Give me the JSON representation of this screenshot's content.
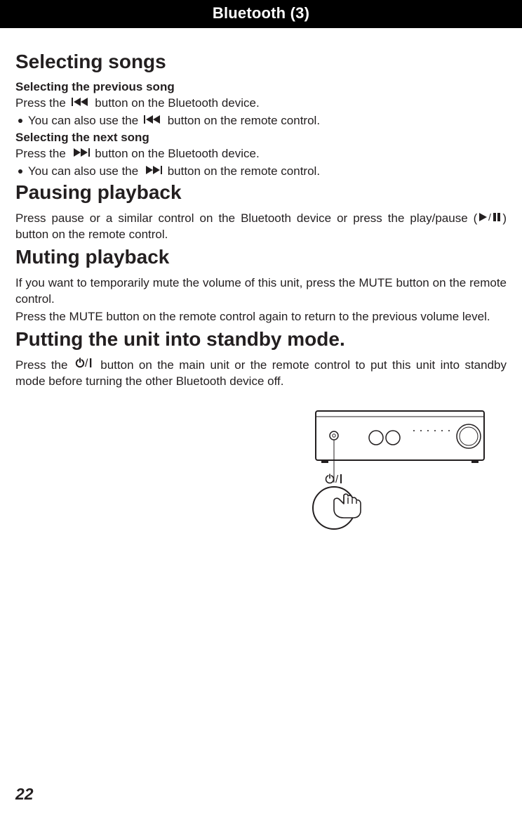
{
  "header": {
    "title": "Bluetooth (3)"
  },
  "page_number": "22",
  "s1": {
    "title": "Selecting songs",
    "sub1": "Selecting the previous song",
    "p1a": "Press the",
    "p1b": "button on the Bluetooth device.",
    "b1a": "You can also use the",
    "b1b": "button on the remote control.",
    "sub2": "Selecting the next song",
    "p2a": "Press the",
    "p2b": "button on the Bluetooth device.",
    "b2a": "You can also use the",
    "b2b": "button on the remote control."
  },
  "s2": {
    "title": "Pausing playback",
    "p1a": "Press pause or a similar control on the Bluetooth device or press the play/pause (",
    "p1b": ") button on the remote control."
  },
  "s3": {
    "title": "Muting playback",
    "p1": "If you want to temporarily mute the volume of this unit, press the MUTE button on the remote control.",
    "p2": "Press the MUTE button on the remote control again to return to the previous volume level."
  },
  "s4": {
    "title": "Putting the unit into standby mode.",
    "p1a": "Press the",
    "p1b": "button on the main unit or the remote control to put this unit into standby mode before turning the other Bluetooth device off."
  }
}
